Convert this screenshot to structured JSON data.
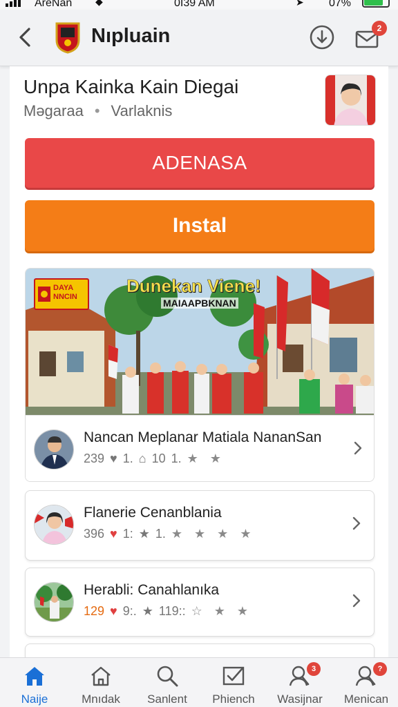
{
  "status_bar": {
    "carrier": "AreNan",
    "time": "0I39 AM",
    "battery_text": "07%"
  },
  "header": {
    "title": "Nıpluain",
    "back_icon": "chevron-left-icon",
    "download_icon": "download-icon",
    "mail_icon": "mail-icon",
    "mail_badge": "2"
  },
  "page": {
    "title": "Unpa Kainka Kain Diegai",
    "meta_left": "Məgaraa",
    "meta_sep": "•",
    "meta_right": "Varlaknis"
  },
  "buttons": {
    "primary_label": "ADENASA",
    "install_label": "Instal"
  },
  "hero": {
    "title": "Dunekan Viene!",
    "subtitle": "MAIAAPBKNAN",
    "sign_line1": "DAYA",
    "sign_line2": "NNCIN"
  },
  "list": [
    {
      "title": "Nancan Meplanar Matiala NananSan",
      "count": "239",
      "likes": "1.",
      "shares": "10",
      "extra": "1.",
      "stars": "★ ★",
      "count_color": "gray",
      "heart_color": "gray"
    },
    {
      "title": "Flanerie Cenanblania",
      "count": "396",
      "likes": "1:",
      "extra": "1.",
      "stars": "★ ★ ★ ★",
      "count_color": "gray",
      "heart_color": "red"
    },
    {
      "title": "Herabli: Canahlanıka",
      "count": "129",
      "likes": "9:.",
      "extra": "119::",
      "stars": "☆ ★ ★",
      "count_color": "orange",
      "heart_color": "red"
    }
  ],
  "tabs": [
    {
      "label": "Naije",
      "icon": "home-icon",
      "active": true
    },
    {
      "label": "Mnıdak",
      "icon": "house-outline-icon"
    },
    {
      "label": "Sanlent",
      "icon": "search-icon"
    },
    {
      "label": "Phiench",
      "icon": "checkbox-icon"
    },
    {
      "label": "Wasijnar",
      "icon": "user-search-icon",
      "badge": "3"
    },
    {
      "label": "Menican",
      "icon": "user-search-icon",
      "badge": "?"
    }
  ],
  "colors": {
    "primary_red": "#e94848",
    "install_orange": "#f47d17",
    "tab_active": "#1a6fd6",
    "badge_red": "#e0453b"
  }
}
